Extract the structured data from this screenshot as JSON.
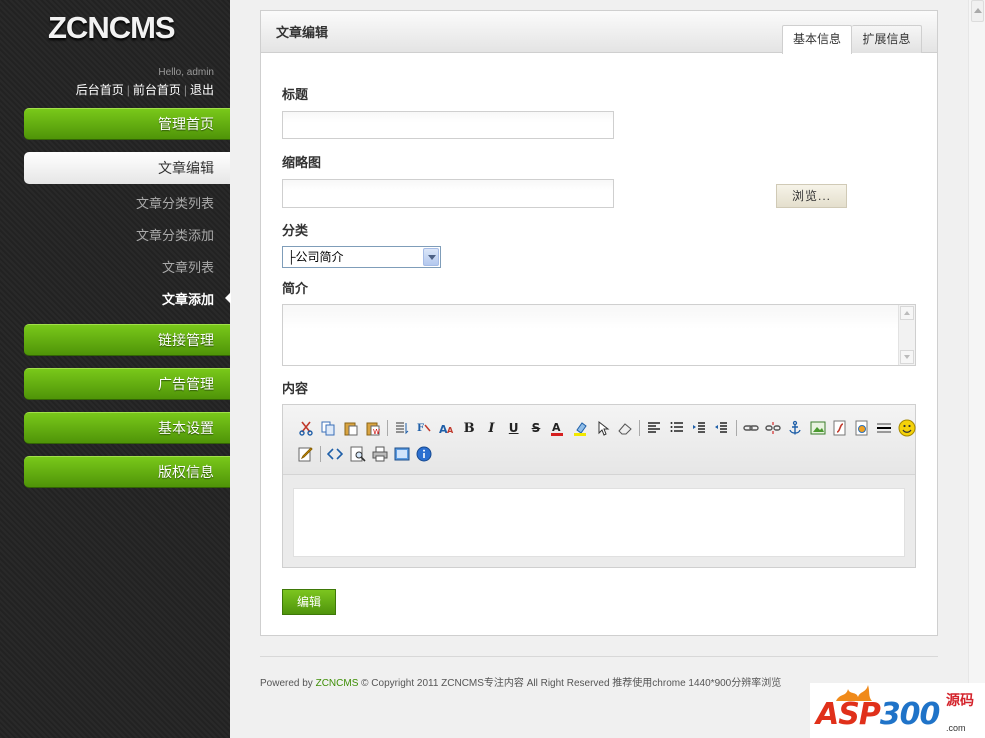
{
  "brand": {
    "logo": "ZCNCMS"
  },
  "user": {
    "greeting": "Hello, admin"
  },
  "toplinks": {
    "admin_home": "后台首页",
    "site_home": "前台首页",
    "logout": "退出",
    "separator": "|"
  },
  "nav": {
    "home": "管理首页",
    "article_edit": "文章编辑",
    "sub": [
      {
        "label": "文章分类列表"
      },
      {
        "label": "文章分类添加"
      },
      {
        "label": "文章列表"
      },
      {
        "label": "文章添加"
      }
    ],
    "links": "链接管理",
    "ads": "广告管理",
    "settings": "基本设置",
    "copyright": "版权信息"
  },
  "panel": {
    "title": "文章编辑",
    "tabs": {
      "basic": "基本信息",
      "extended": "扩展信息"
    }
  },
  "form": {
    "title_label": "标题",
    "title_value": "",
    "thumb_label": "缩略图",
    "thumb_value": "",
    "browse_label": "浏览...",
    "category_label": "分类",
    "category_value": "├公司简介",
    "summary_label": "简介",
    "summary_value": "",
    "content_label": "内容",
    "submit_label": "编辑"
  },
  "editor_toolbar": {
    "row1": [
      "cut-icon",
      "copy-icon",
      "paste-icon",
      "paste-text-icon",
      "|",
      "format-icon",
      "font-icon",
      "font-size-icon",
      "bold-icon",
      "italic-icon",
      "underline-icon",
      "strikethrough-icon",
      "font-color-icon",
      "highlight-icon",
      "select-icon",
      "eraser-icon",
      "|",
      "align-left-icon",
      "list-icon",
      "indent-icon",
      "outdent-icon",
      "|",
      "link-icon",
      "unlink-icon",
      "anchor-icon",
      "image-icon",
      "flash-icon",
      "media-icon",
      "hr-icon",
      "emoticon-icon"
    ],
    "row2": [
      "edit-icon",
      "|",
      "source-icon",
      "preview-icon",
      "print-icon",
      "fullscreen-icon",
      "about-icon"
    ]
  },
  "footer": {
    "powered_by": "Powered by",
    "brand": "ZCNCMS",
    "rest": "© Copyright 2011 ZCNCMS专注内容  All Right Reserved 推荐使用chrome 1440*900分辨率浏览"
  },
  "watermark": {
    "text_a": "ASP",
    "text_b": "300",
    "cn": "源码",
    "domain": ".com"
  }
}
